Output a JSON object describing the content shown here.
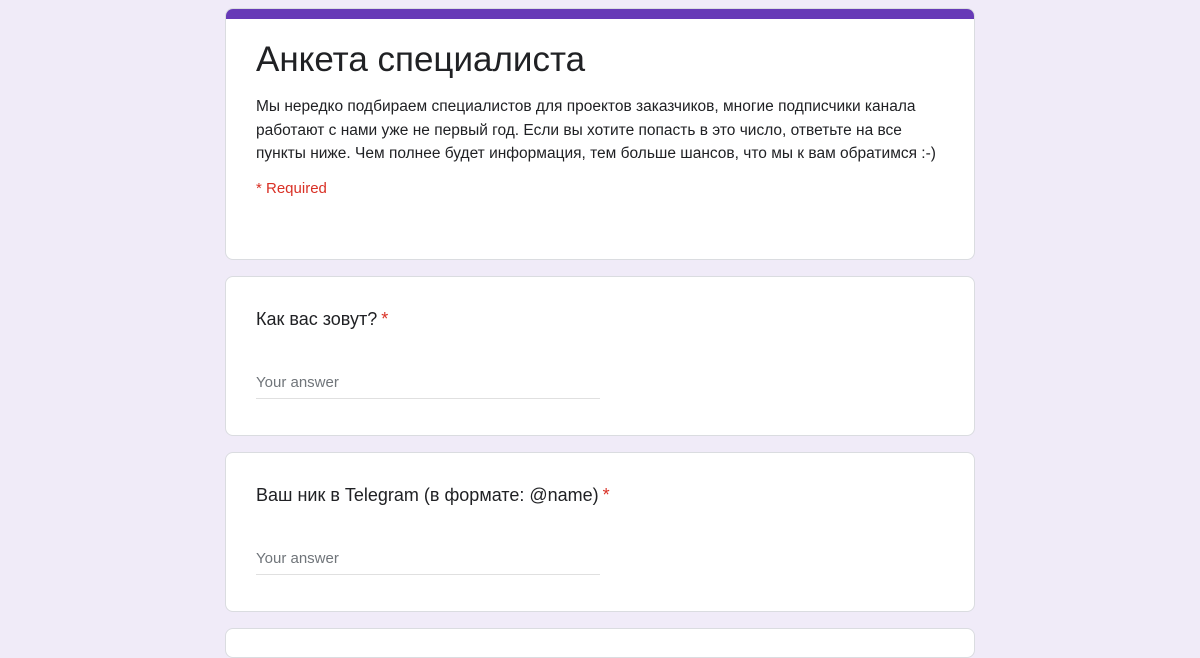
{
  "form": {
    "title": "Анкета специалиста",
    "description": "Мы нередко подбираем специалистов для проектов заказчиков, многие подписчики канала работают с нами уже не первый год. Если вы хотите попасть в это число, ответьте на все пункты ниже. Чем полнее будет информация, тем больше шансов, что мы к вам обратимся :-)",
    "required_note": "* Required",
    "accent_color": "#673ab7",
    "required_color": "#d93025"
  },
  "questions": [
    {
      "title": "Как вас зовут?",
      "required_mark": "*",
      "answer_placeholder": "Your answer"
    },
    {
      "title": "Ваш ник в Telegram (в формате: @name)",
      "required_mark": "*",
      "answer_placeholder": "Your answer"
    }
  ]
}
